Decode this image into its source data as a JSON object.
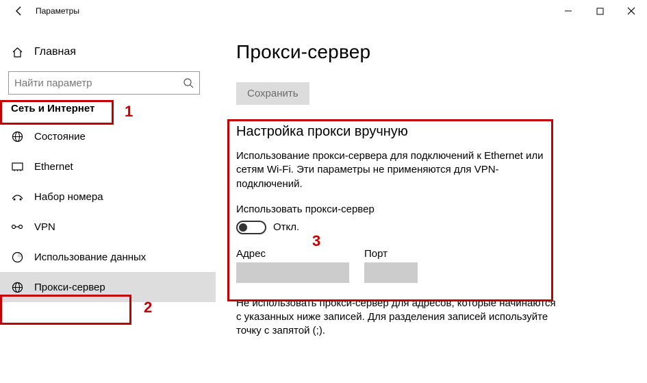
{
  "titlebar": {
    "title": "Параметры"
  },
  "sidebar": {
    "home_label": "Главная",
    "search_placeholder": "Найти параметр",
    "section_title": "Сеть и Интернет",
    "items": [
      {
        "label": "Состояние",
        "icon": "status-icon"
      },
      {
        "label": "Ethernet",
        "icon": "ethernet-icon"
      },
      {
        "label": "Набор номера",
        "icon": "dialup-icon"
      },
      {
        "label": "VPN",
        "icon": "vpn-icon"
      },
      {
        "label": "Использование данных",
        "icon": "data-usage-icon"
      },
      {
        "label": "Прокси-сервер",
        "icon": "proxy-icon"
      }
    ]
  },
  "main": {
    "page_title": "Прокси-сервер",
    "save_label": "Сохранить",
    "manual": {
      "heading": "Настройка прокси вручную",
      "desc": "Использование прокси-сервера для подключений к Ethernet или сетям Wi-Fi. Эти параметры не применяются для VPN-подключений.",
      "toggle_label": "Использовать прокси-сервер",
      "toggle_state": "Откл.",
      "address_label": "Адрес",
      "address_value": "",
      "port_label": "Порт",
      "port_value": "",
      "exclusion_desc": "Не использовать прокси-сервер для адресов, которые начинаются с указанных ниже записей. Для разделения записей используйте точку с запятой (;)."
    }
  },
  "annotations": {
    "n1": "1",
    "n2": "2",
    "n3": "3"
  }
}
